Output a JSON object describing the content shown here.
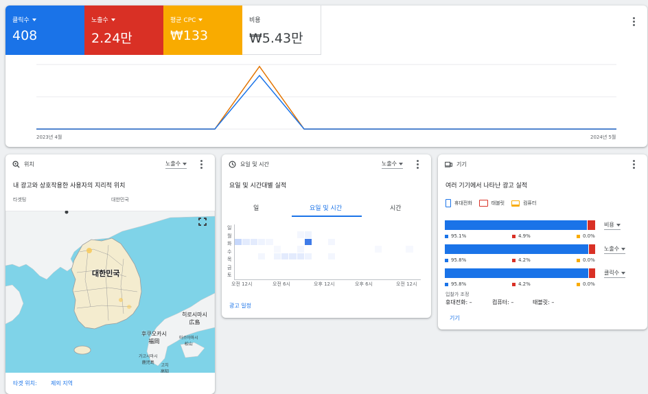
{
  "summary": {
    "tiles": [
      {
        "label": "클릭수",
        "value": "408",
        "color": "#1a73e8"
      },
      {
        "label": "노출수",
        "value": "2.24만",
        "color": "#d93025"
      },
      {
        "label": "평균 CPC",
        "value": "₩133",
        "color": "#f9ab00"
      },
      {
        "label": "비용",
        "value": "₩5.43만",
        "color": "#ffffff"
      }
    ],
    "chart_start_label": "2023년 4월",
    "chart_end_label": "2024년 5월"
  },
  "chart_data": {
    "type": "line",
    "x": [
      0,
      1,
      2,
      3,
      4,
      5,
      6,
      7,
      8,
      9,
      10,
      11,
      12,
      13
    ],
    "series": [
      {
        "values": [
          0,
          0,
          0,
          0,
          0,
          0.97,
          0,
          0,
          0,
          0,
          0,
          0,
          0,
          0
        ],
        "color": "#e37400"
      },
      {
        "values": [
          0,
          0,
          0,
          0,
          0,
          0.83,
          0,
          0,
          0,
          0,
          0,
          0,
          0,
          0
        ],
        "color": "#1a73e8"
      }
    ],
    "grid": true
  },
  "location": {
    "title": "위치",
    "metric": "노출수",
    "subtitle": "내 광고와 상호작용한 사용자의 지리적 위치",
    "target_label": "타겟팅",
    "target_value": "대한민국",
    "map_labels": {
      "country": "대한민국",
      "hiroshima": "히로시마시",
      "hiroshima_jp": "広島",
      "fukuoka": "후쿠오카시",
      "fukuoka_jp": "福岡",
      "matsuyama": "마쓰야마시",
      "matsuyama_jp": "松山",
      "kagoshima": "가고시마시",
      "kagoshima_jp": "鹿児島",
      "kochi": "고치",
      "kochi_jp": "高知"
    },
    "footer_target": "타겟 위치:",
    "footer_excluded": "제외 지역"
  },
  "schedule": {
    "title": "요일 및 시간",
    "metric": "노출수",
    "subtitle": "요일 및 시간대별 실적",
    "tabs": [
      "일",
      "요일 및 시간",
      "시간"
    ],
    "active_tab": 1,
    "days": [
      "일",
      "월",
      "화",
      "수",
      "목",
      "금",
      "토"
    ],
    "times": [
      "오전 12시",
      "오전 6시",
      "오후 12시",
      "오후 6시",
      "오전 12시"
    ],
    "footer_link": "광고 일정"
  },
  "devices": {
    "title": "기기",
    "subtitle": "여러 기기에서 나타난 광고 실적",
    "legend": [
      {
        "label": "휴대전화",
        "color": "#1a73e8"
      },
      {
        "label": "태블릿",
        "color": "#d93025"
      },
      {
        "label": "컴퓨터",
        "color": "#f9ab00"
      }
    ],
    "rows": [
      {
        "metric": "비용",
        "mobile": "95.1%",
        "tablet": "4.9%",
        "desktop": "0.0%",
        "mobile_frac": 0.951,
        "tablet_frac": 0.049
      },
      {
        "metric": "노출수",
        "mobile": "95.8%",
        "tablet": "4.2%",
        "desktop": "0.0%",
        "mobile_frac": 0.958,
        "tablet_frac": 0.042
      },
      {
        "metric": "클릭수",
        "mobile": "95.8%",
        "tablet": "4.2%",
        "desktop": "0.0%",
        "mobile_frac": 0.958,
        "tablet_frac": 0.042
      }
    ],
    "bid_adj_label": "입찰가 조정",
    "bid_mobile": "휴대전화: –",
    "bid_desktop": "컴퓨터: –",
    "bid_tablet": "태블릿: –",
    "footer_link": "기기"
  }
}
